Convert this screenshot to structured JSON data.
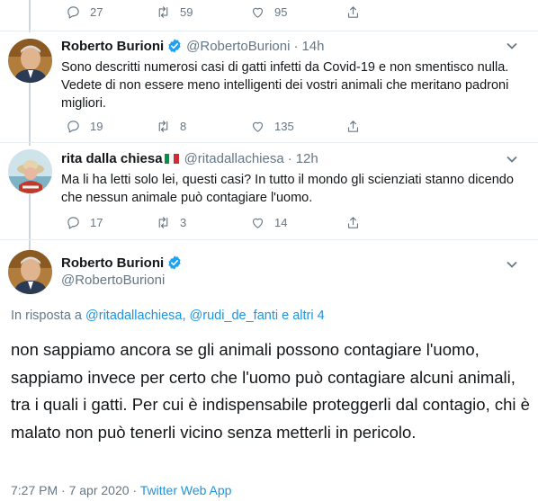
{
  "top_actions": {
    "replies": "27",
    "retweets": "59",
    "likes": "95"
  },
  "tweet1": {
    "name": "Roberto Burioni",
    "handle": "@RobertoBurioni",
    "separator": "·",
    "time": "14h",
    "text": "Sono descritti numerosi casi di gatti infetti da Covid-19 e non smentisco nulla. Vedete di non essere meno intelligenti dei vostri animali che meritano padroni migliori.",
    "replies": "19",
    "retweets": "8",
    "likes": "135"
  },
  "tweet2": {
    "name": "rita dalla chiesa",
    "handle": "@ritadallachiesa",
    "separator": "·",
    "time": "12h",
    "text": "Ma li ha letti solo lei, questi casi? In tutto il mondo gli scienziati stanno dicendo che nessun animale può contagiare l'uomo.",
    "replies": "17",
    "retweets": "3",
    "likes": "14"
  },
  "main_tweet": {
    "name": "Roberto Burioni",
    "handle": "@RobertoBurioni",
    "reply_prefix": "In risposta a",
    "reply_user1": "@ritadallachiesa",
    "reply_sep": ",",
    "reply_user2": "@rudi_de_fanti",
    "reply_suffix": "e altri 4",
    "text": "non sappiamo ancora se gli animali possono contagiare l'uomo, sappiamo invece per certo che l'uomo può contagiare alcuni animali, tra i quali i gatti. Per cui è indispensabile proteggerli dal contagio, chi è malato non può tenerli vicino senza metterli in pericolo.",
    "time": "7:27 PM",
    "meta_sep": "·",
    "date": "7 apr 2020",
    "meta_sep2": "·",
    "source": "Twitter Web App"
  },
  "colors": {
    "link": "#1b95e0",
    "verified": "#1da1f2",
    "muted": "#657786",
    "divider": "#e6ecf0"
  },
  "icons": [
    "reply-icon",
    "retweet-icon",
    "like-icon",
    "share-icon",
    "verified-icon",
    "chevron-down-icon",
    "italian-flag-icon"
  ]
}
